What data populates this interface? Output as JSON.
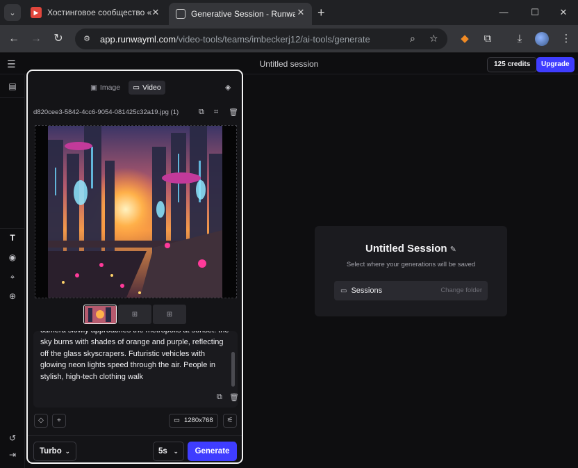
{
  "browser": {
    "tabs": [
      {
        "title": "Хостинговое сообщество «Tim",
        "favicon_color": "#e0463c"
      },
      {
        "title": "Generative Session - Runway",
        "favicon_color": "#3a3a40"
      }
    ],
    "url_host": "app.runwayml.com",
    "url_path": "/video-tools/teams/imbeckerj12/ai-tools/generate"
  },
  "app": {
    "session_title": "Untitled session",
    "credits": "125 credits",
    "upgrade_label": "Upgrade"
  },
  "panel": {
    "mode_tabs": [
      "Image",
      "Video"
    ],
    "active_mode": "Video",
    "filename": "d820cee3-5842-4cc6-9054-081425c32a19.jpg (1)",
    "prompt": "camera slowly approaches the metropolis at sunset: the sky burns with shades of orange and purple, reflecting off the glass skyscrapers. Futuristic vehicles with glowing neon lights speed through the air. People in stylish, high-tech clothing walk",
    "resolution": "1280x768",
    "model": "Turbo",
    "duration": "5s",
    "generate_label": "Generate"
  },
  "card": {
    "title": "Untitled Session",
    "subtitle": "Select where your generations will be saved",
    "folder_name": "Sessions",
    "change_folder_label": "Change folder"
  },
  "colors": {
    "accent": "#3f3dff",
    "panel_border": "#f4f4f4"
  }
}
